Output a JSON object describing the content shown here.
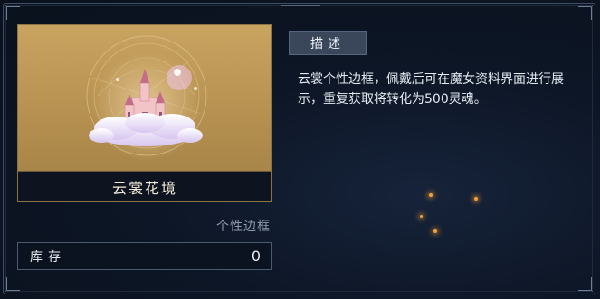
{
  "item": {
    "name": "云裳花境",
    "type": "个性边框",
    "stock_label": "库存",
    "stock_value": "0"
  },
  "description": {
    "tab_label": "描述",
    "text": "云裳个性边框，佩戴后可在魔女资料界面进行展示，重复获取将转化为500灵魂。"
  },
  "colors": {
    "background": "#0d1626",
    "card_gold": "#b48f4f",
    "tag_bg": "#3a475a"
  },
  "icons": [
    "castle-on-cloud-art",
    "celestial-circle-decoration"
  ]
}
